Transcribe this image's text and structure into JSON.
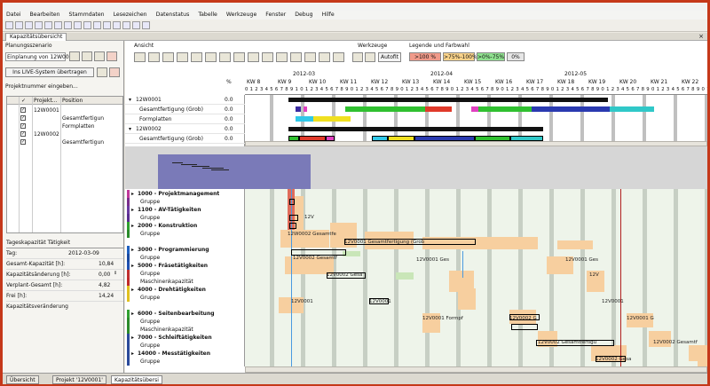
{
  "window": {
    "title": "Kapazitätsübersicht",
    "menu": [
      "Datei",
      "Bearbeiten",
      "Stammdaten",
      "Lesezeichen",
      "Datenstatus",
      "Tabelle",
      "Werkzeuge",
      "Fenster",
      "Debug",
      "Hilfe"
    ]
  },
  "doc_tab": "Kapazitätsübersicht",
  "left": {
    "planungsszenario_label": "Planungsszenario",
    "scenario_value": "Einplanung von 12W00",
    "live_button": "Ins LIVE-System übertragen",
    "projekt_label": "Projektnummer eingeben...",
    "col_projekt": "Projekt...",
    "col_position": "Position",
    "rows": [
      {
        "proj": "12W0001",
        "pos": ""
      },
      {
        "proj": "",
        "pos": "Gesamtfertigun"
      },
      {
        "proj": "",
        "pos": "Formplatten"
      },
      {
        "proj": "12W0002",
        "pos": ""
      },
      {
        "proj": "",
        "pos": "Gesamtfertigun"
      }
    ],
    "kap_title": "Tageskapazität Tätigkeit",
    "tag_label": "Tag:",
    "tag_value": "2012-03-09",
    "gk_label": "Gesamt-Kapazität [h]:",
    "gk_value": "10,84",
    "ka_label": "Kapazitätsänderung [h]:",
    "ka_value": "0,00",
    "vg_label": "Verplant-Gesamt [h]:",
    "vg_value": "4,82",
    "fr_label": "Frei [h]:",
    "fr_value": "14,24",
    "kv_label": "Kapazitätsveränderung"
  },
  "right": {
    "ansicht": "Ansicht",
    "werkzeuge": "Werkzeuge",
    "legende": "Legende und Farbwahl",
    "autofit": "Autofit",
    "legend": [
      {
        "label": ">100 %",
        "color": "#f09a8a"
      },
      {
        "label": ">75%-100%",
        "color": "#f8d28a"
      },
      {
        "label": ">0%-75%",
        "color": "#8fe08f"
      },
      {
        "label": "0%",
        "color": "#e6e6e6"
      }
    ],
    "pct_col": "%",
    "months": [
      "2012-03",
      "2012-04",
      "2012-05"
    ],
    "weeks": [
      "KW 8",
      "KW 9",
      "KW 10",
      "KW 11",
      "KW 12",
      "KW 13",
      "KW 14",
      "KW 15",
      "KW 16",
      "KW 17",
      "KW 18",
      "KW 19",
      "KW 20",
      "KW 21",
      "KW 22"
    ],
    "day_digits": "0 1 2 3 4 5 6 7 8 9 1 0 1 2 3 4 5 6 7 8 9 0 1 2 3 4 5 6 7 8 9 0 1 2 3 4 5 6 7 8 9 0 1 2 3 4 5 6 7 8 9 0 1 2 3 4 5 6 7 8 9 0 1 2 3 4 5 6 7 8 9 0 1 2 3 4 5 6 7 8 9 0 1 2 3 4 5 6 7 8 9 0 1 2",
    "tasks": [
      {
        "name": "12W0001",
        "pct": "0.0"
      },
      {
        "name": "Gesamtfertigung (Grob)",
        "pct": "0.0"
      },
      {
        "name": "Formplatten",
        "pct": "0.0"
      },
      {
        "name": "12W0002",
        "pct": "0.0"
      },
      {
        "name": "Gesamtfertigung (Grob)",
        "pct": "0.0"
      }
    ],
    "resources": [
      {
        "name": "1000 - Projektmanagement",
        "bold": true,
        "color": "#c0389a"
      },
      {
        "name": "Gruppe",
        "bold": false,
        "color": "#7a2e8c"
      },
      {
        "name": "1100 - AV-Tätigkeiten",
        "bold": true,
        "color": "#6a3aa0"
      },
      {
        "name": "Gruppe",
        "bold": false,
        "color": "#5a2e90"
      },
      {
        "name": "2000 - Konstruktion",
        "bold": true,
        "color": "#30a030"
      },
      {
        "name": "Gruppe",
        "bold": false,
        "color": "#2a8a2a"
      },
      {
        "name": "",
        "bold": false,
        "color": ""
      },
      {
        "name": "3000 - Programmierung",
        "bold": true,
        "color": "#2060c0"
      },
      {
        "name": "Gruppe",
        "bold": false,
        "color": "#1a4aa0"
      },
      {
        "name": "5000 - Fräsetätigkeiten",
        "bold": true,
        "color": "#2050b0"
      },
      {
        "name": "Gruppe",
        "bold": false,
        "color": "#c03030"
      },
      {
        "name": "Maschinenkapazität",
        "bold": false,
        "color": "#c02a2a"
      },
      {
        "name": "4000 - Drehtätigkeiten",
        "bold": true,
        "color": "#e0c020"
      },
      {
        "name": "Gruppe",
        "bold": false,
        "color": "#e0c020"
      },
      {
        "name": "",
        "bold": false,
        "color": ""
      },
      {
        "name": "6000 - Seitenbearbeitung",
        "bold": true,
        "color": "#30a030"
      },
      {
        "name": "Gruppe",
        "bold": false,
        "color": "#2a8a2a"
      },
      {
        "name": "Maschinenkapazität",
        "bold": false,
        "color": "#2a8a2a"
      },
      {
        "name": "7000 - Schleiftätigkeiten",
        "bold": true,
        "color": "#2a4a9a"
      },
      {
        "name": "Gruppe",
        "bold": false,
        "color": "#2a4a9a"
      },
      {
        "name": "14000 - Messtätigkeiten",
        "bold": true,
        "color": "#2a4a9a"
      },
      {
        "name": "Gruppe",
        "bold": false,
        "color": "#2a4a9a"
      }
    ],
    "labels": {
      "a": "12V",
      "b": "12W0002 Gesamtfe",
      "c": "12V0001 Gesamtfertigung (Grob",
      "d": "12V0002 Gesamtf",
      "e": "12V0001 Ges",
      "f": "12V0002 Gesa",
      "g": "12V",
      "h": "12V0001",
      "i": "12V0001",
      "j": "12V0001 Formpf",
      "k": "12V0002 G",
      "l": "12V0001 G",
      "m": "12V0001",
      "n": "12V0002 Gesamtfertigu",
      "o": "12V0002 Gesamtf",
      "p": "12V0002 Gesa"
    }
  },
  "bottom_tabs": [
    "Übersicht",
    "Projekt '12V0001'",
    "Kapazitätsübersi"
  ]
}
